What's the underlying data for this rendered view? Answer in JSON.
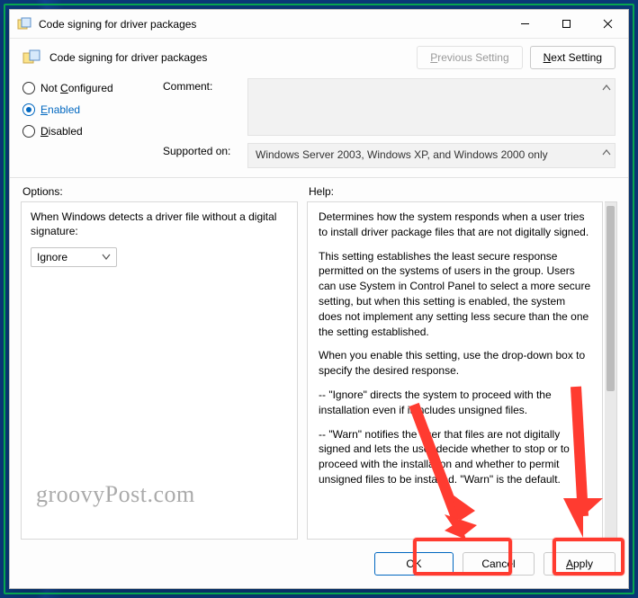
{
  "window": {
    "title": "Code signing for driver packages"
  },
  "header": {
    "title": "Code signing for driver packages",
    "previous_btn_text": "Previous Setting",
    "previous_btn_ul": "P",
    "next_btn_text": "Next Setting",
    "next_btn_ul": "N"
  },
  "radios": {
    "not_configured": {
      "label": "Not Configured",
      "underline": "C"
    },
    "enabled": {
      "label": "Enabled",
      "underline": "E"
    },
    "disabled": {
      "label": "Disabled",
      "underline": "D"
    }
  },
  "fields": {
    "comment_label": "Comment:",
    "comment_value": "",
    "supported_label": "Supported on:",
    "supported_value": "Windows Server 2003, Windows XP, and Windows 2000 only"
  },
  "labels": {
    "options": "Options:",
    "help": "Help:"
  },
  "options": {
    "text": "When Windows detects a driver file without a digital signature:",
    "select_value": "Ignore"
  },
  "help": {
    "p1": "Determines how the system responds when a user tries to install driver package files that are not digitally signed.",
    "p2": "This setting establishes the least secure response permitted on the systems of users in the group. Users can use System in Control Panel to select a more secure setting, but when this setting is enabled, the system does not implement any setting less secure than the one the setting established.",
    "p3": "When you enable this setting, use the drop-down box to specify the desired response.",
    "p4": "--   \"Ignore\" directs the system to proceed with the installation even if it includes unsigned files.",
    "p5": "--   \"Warn\" notifies the user that files are not digitally signed and lets the user decide whether to stop or to proceed with the installation and whether to permit unsigned files to be installed. \"Warn\" is the default."
  },
  "footer": {
    "ok": "OK",
    "cancel": "Cancel",
    "apply": "Apply"
  },
  "watermark": "groovyPost.com"
}
